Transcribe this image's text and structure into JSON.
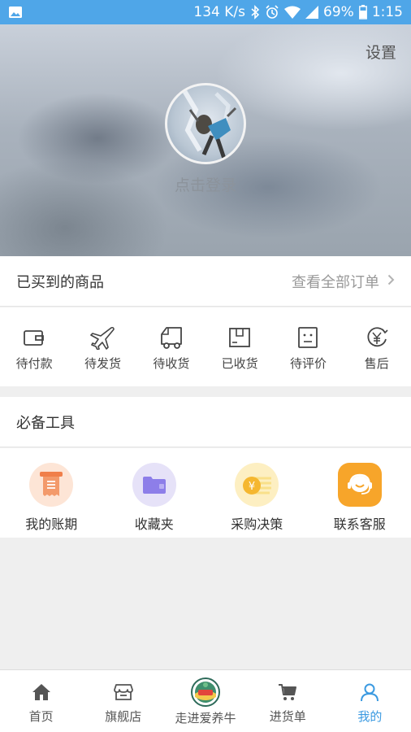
{
  "status_bar": {
    "speed": "134 K/s",
    "battery": "69%",
    "time": "1:15",
    "bg_color": "#4fa6e8"
  },
  "header": {
    "settings_label": "设置",
    "login_label": "点击登录"
  },
  "orders": {
    "title": "已买到的商品",
    "view_all_label": "查看全部订单",
    "items": [
      {
        "label": "待付款",
        "icon": "wallet-icon"
      },
      {
        "label": "待发货",
        "icon": "airplane-icon"
      },
      {
        "label": "待收货",
        "icon": "truck-icon"
      },
      {
        "label": "已收货",
        "icon": "box-icon"
      },
      {
        "label": "待评价",
        "icon": "review-icon"
      },
      {
        "label": "售后",
        "icon": "yen-refund-icon"
      }
    ]
  },
  "tools": {
    "title": "必备工具",
    "items": [
      {
        "label": "我的账期",
        "icon": "receipt-icon",
        "color": "#f08a4b"
      },
      {
        "label": "收藏夹",
        "icon": "folder-icon",
        "color": "#8c7be8"
      },
      {
        "label": "采购决策",
        "icon": "coin-icon",
        "color": "#f5c23a"
      },
      {
        "label": "联系客服",
        "icon": "headset-icon",
        "color": "#f5a623"
      }
    ]
  },
  "nav": {
    "items": [
      {
        "label": "首页",
        "icon": "home-icon"
      },
      {
        "label": "旗舰店",
        "icon": "store-icon"
      },
      {
        "label": "走进爱养牛",
        "icon": "logo-icon"
      },
      {
        "label": "进货单",
        "icon": "cart-icon"
      },
      {
        "label": "我的",
        "icon": "person-icon"
      }
    ],
    "active_color": "#3b9ae1"
  }
}
